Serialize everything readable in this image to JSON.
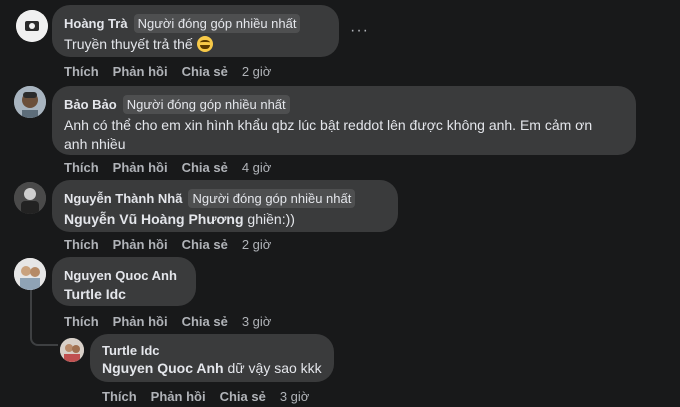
{
  "comments": [
    {
      "author": "Hoàng Trà",
      "badge": "Người đóng góp nhiều nhất",
      "text": "Truyền thuyết trả thế",
      "emoji": "grinning-sweat-emoji",
      "actions": {
        "like": "Thích",
        "reply": "Phản hồi",
        "share": "Chia sẻ",
        "time": "2 giờ"
      },
      "more": "···"
    },
    {
      "author": "Bảo Bảo",
      "badge": "Người đóng góp nhiều nhất",
      "text_line1": "Anh có thể cho em xin hình khẩu qbz lúc bật reddot lên được không anh. Em cảm ơn",
      "text_line2": "anh nhiều",
      "actions": {
        "like": "Thích",
        "reply": "Phản hồi",
        "share": "Chia sẻ",
        "time": "4 giờ"
      }
    },
    {
      "author": "Nguyễn Thành Nhã",
      "badge": "Người đóng góp nhiều nhất",
      "mention": "Nguyễn Vũ Hoàng Phương",
      "text": " ghiền:))",
      "actions": {
        "like": "Thích",
        "reply": "Phản hồi",
        "share": "Chia sẻ",
        "time": "2 giờ"
      }
    },
    {
      "author": "Nguyen Quoc Anh",
      "mention": "Turtle Idc",
      "actions": {
        "like": "Thích",
        "reply": "Phản hồi",
        "share": "Chia sẻ",
        "time": "3 giờ"
      }
    },
    {
      "author": "Turtle Idc",
      "mention": "Nguyen Quoc Anh",
      "text": " dữ vậy sao kkk",
      "actions": {
        "like": "Thích",
        "reply": "Phản hồi",
        "share": "Chia sẻ",
        "time": "3 giờ"
      }
    }
  ]
}
